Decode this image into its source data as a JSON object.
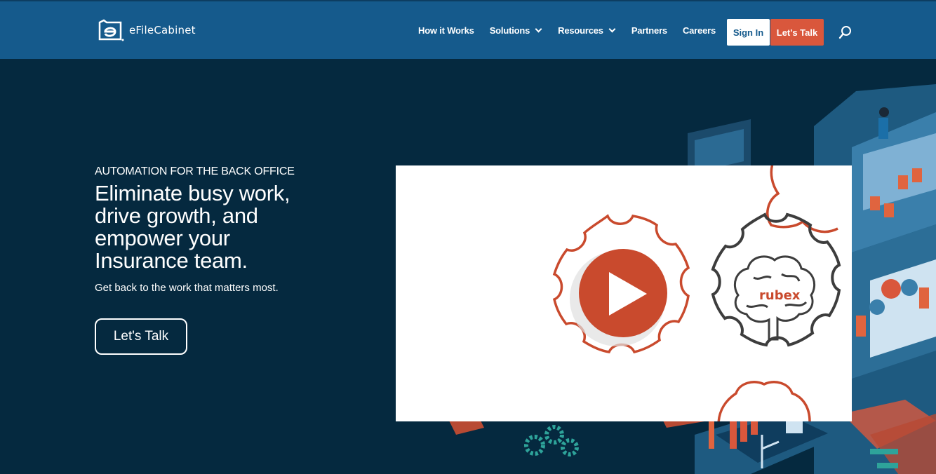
{
  "brand": {
    "name": "eFileCabinet",
    "logo_icon": "efilecabinet-logo-icon"
  },
  "nav": {
    "items": [
      {
        "label": "How it Works",
        "has_dropdown": false
      },
      {
        "label": "Solutions",
        "has_dropdown": true
      },
      {
        "label": "Resources",
        "has_dropdown": true
      },
      {
        "label": "Partners",
        "has_dropdown": false
      },
      {
        "label": "Careers",
        "has_dropdown": false
      }
    ],
    "signin_label": "Sign In",
    "talk_label": "Let's Talk",
    "search_icon": "search-icon"
  },
  "hero": {
    "eyebrow": "AUTOMATION FOR THE BACK OFFICE",
    "title": "Eliminate busy work, drive growth, and empower your Insurance team.",
    "subtitle": "Get back to the work that matters most.",
    "cta_label": "Let's Talk"
  },
  "video": {
    "brand_text": "rubex",
    "play_icon": "play-icon"
  },
  "colors": {
    "header_bg": "#155a8c",
    "page_bg": "#05293f",
    "accent": "#d9573c",
    "white": "#ffffff"
  }
}
